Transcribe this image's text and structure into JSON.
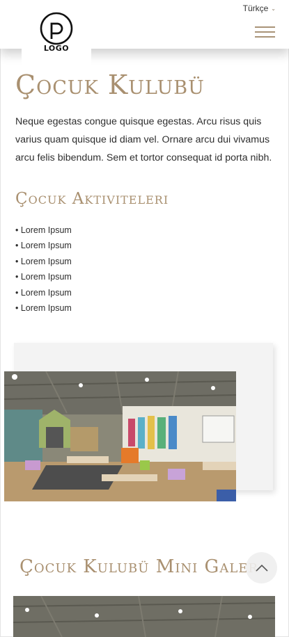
{
  "header": {
    "logo_text": "LOGO",
    "language": "Türkçe",
    "menu_icon": "hamburger-menu-icon"
  },
  "main": {
    "title": "Çocuk Kulubü",
    "intro": "Neque egestas congue quisque egestas. Arcu risus quis varius quam quisque id diam vel. Ornare arcu dui vivamus arcu felis bibendum. Sem et tortor consequat id porta nibh.",
    "activities_title": "Çocuk Aktiviteleri",
    "activities": [
      "Lorem Ipsum",
      "Lorem Ipsum",
      "Lorem Ipsum",
      "Lorem Ipsum",
      "Lorem Ipsum",
      "Lorem Ipsum"
    ]
  },
  "gallery": {
    "title": "Çocuk Kulubü Mini Galeri"
  },
  "colors": {
    "accent": "#a99070",
    "text": "#2e2e2e",
    "card": "#f3f3f3"
  },
  "icons": {
    "scroll_top": "chevron-up-icon",
    "language": "chevron-down-icon"
  }
}
